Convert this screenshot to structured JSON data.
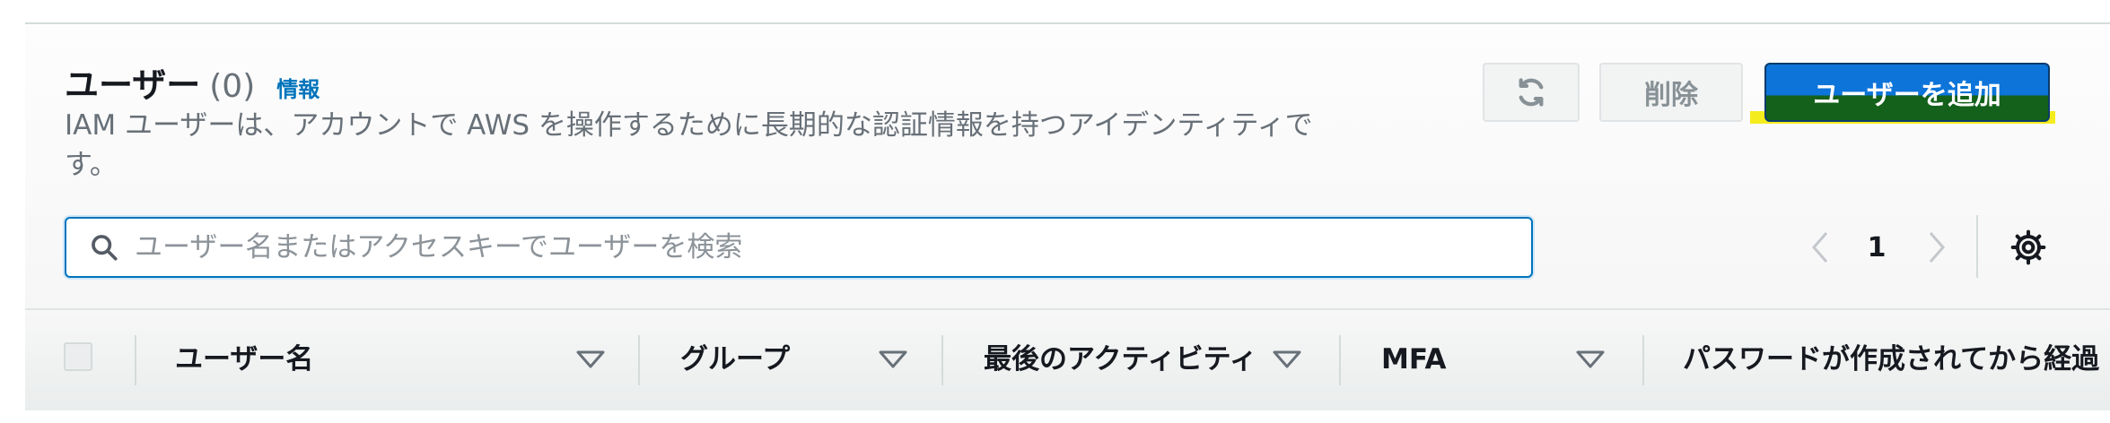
{
  "panel": {
    "title": "ユーザー",
    "count": "(0)",
    "info_link": "情報",
    "description": "IAM ユーザーは、アカウントで AWS を操作するために長期的な認証情報を持つアイデンティティです。"
  },
  "actions": {
    "refresh_icon": "refresh-icon",
    "delete_label": "削除",
    "add_user_label": "ユーザーを追加"
  },
  "search": {
    "placeholder": "ユーザー名またはアクセスキーでユーザーを検索",
    "value": ""
  },
  "pagination": {
    "current_page": "1"
  },
  "table": {
    "columns": [
      {
        "label": "ユーザー名"
      },
      {
        "label": "グループ"
      },
      {
        "label": "最後のアクティビティ"
      },
      {
        "label": "MFA"
      },
      {
        "label": "パスワードが作成されてから経過"
      }
    ]
  },
  "colors": {
    "primary": "#0d74d9",
    "link": "#0073bb",
    "highlight": "#f5ec1d",
    "text": "#16191f",
    "muted": "#687078"
  }
}
